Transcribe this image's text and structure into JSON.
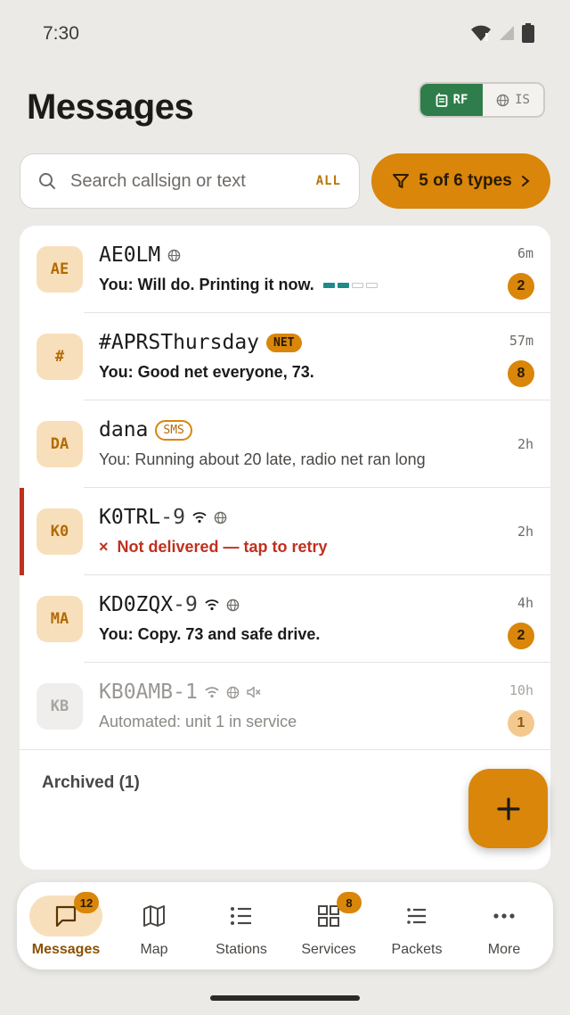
{
  "status_bar": {
    "time": "7:30"
  },
  "header": {
    "title": "Messages"
  },
  "mode_toggle": {
    "rf_label": "RF",
    "is_label": "IS",
    "active": "RF"
  },
  "search": {
    "placeholder": "Search callsign or text",
    "scope": "ALL"
  },
  "filter": {
    "label": "5 of 6 types"
  },
  "conversations": [
    {
      "avatar": "AE",
      "callsign": "AE0LM",
      "ssid": "",
      "preview": "You: Will do. Printing it now.",
      "time": "6m",
      "unread": "2",
      "delivery_progress": 0.5
    },
    {
      "avatar": "#",
      "callsign": "#APRSThursday",
      "ssid": "",
      "tag": "NET",
      "preview": "You: Good net everyone, 73.",
      "time": "57m",
      "unread": "8"
    },
    {
      "avatar": "DA",
      "callsign": "dana",
      "ssid": "",
      "tag": "SMS",
      "preview": "You: Running about 20 late, radio net ran long",
      "time": "2h"
    },
    {
      "avatar": "K0",
      "callsign": "K0TRL",
      "ssid": "-9",
      "preview": "Not delivered — tap to retry",
      "error_mark": "×",
      "time": "2h"
    },
    {
      "avatar": "MA",
      "callsign": "KD0ZQX",
      "ssid": "-9",
      "preview": "You: Copy. 73 and safe drive.",
      "time": "4h",
      "unread": "2"
    },
    {
      "avatar": "KB",
      "callsign": "KB0AMB",
      "ssid": "-1",
      "preview": "Automated: unit 1 in service",
      "time": "10h",
      "unread": "1"
    }
  ],
  "archived": {
    "label": "Archived (1)"
  },
  "nav": [
    {
      "label": "Messages",
      "badge": "12",
      "icon": "chat-icon",
      "active": true
    },
    {
      "label": "Map",
      "icon": "map-icon"
    },
    {
      "label": "Stations",
      "icon": "list-icon"
    },
    {
      "label": "Services",
      "badge": "8",
      "icon": "grid-icon"
    },
    {
      "label": "Packets",
      "icon": "packets-icon"
    },
    {
      "label": "More",
      "icon": "more-icon"
    }
  ],
  "colors": {
    "accent": "#D9860A",
    "rf_green": "#2E7D4A",
    "error": "#C0301F",
    "teal": "#1E8A8A"
  }
}
